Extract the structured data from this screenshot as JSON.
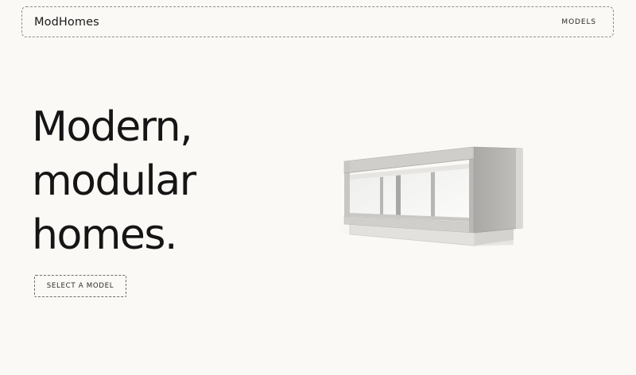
{
  "header": {
    "brand": "ModHomes",
    "nav_models": "MODELS"
  },
  "hero": {
    "title_lines": [
      "Modern,",
      "modular",
      "homes."
    ],
    "cta_label": "SELECT A MODEL"
  },
  "illustration": {
    "icon": "modular-home-render",
    "colors": {
      "frame": "#c9c8c5",
      "frame_dark": "#9f9e9b",
      "glass": "#f3f3f1",
      "base": "#e4e3e0"
    }
  }
}
